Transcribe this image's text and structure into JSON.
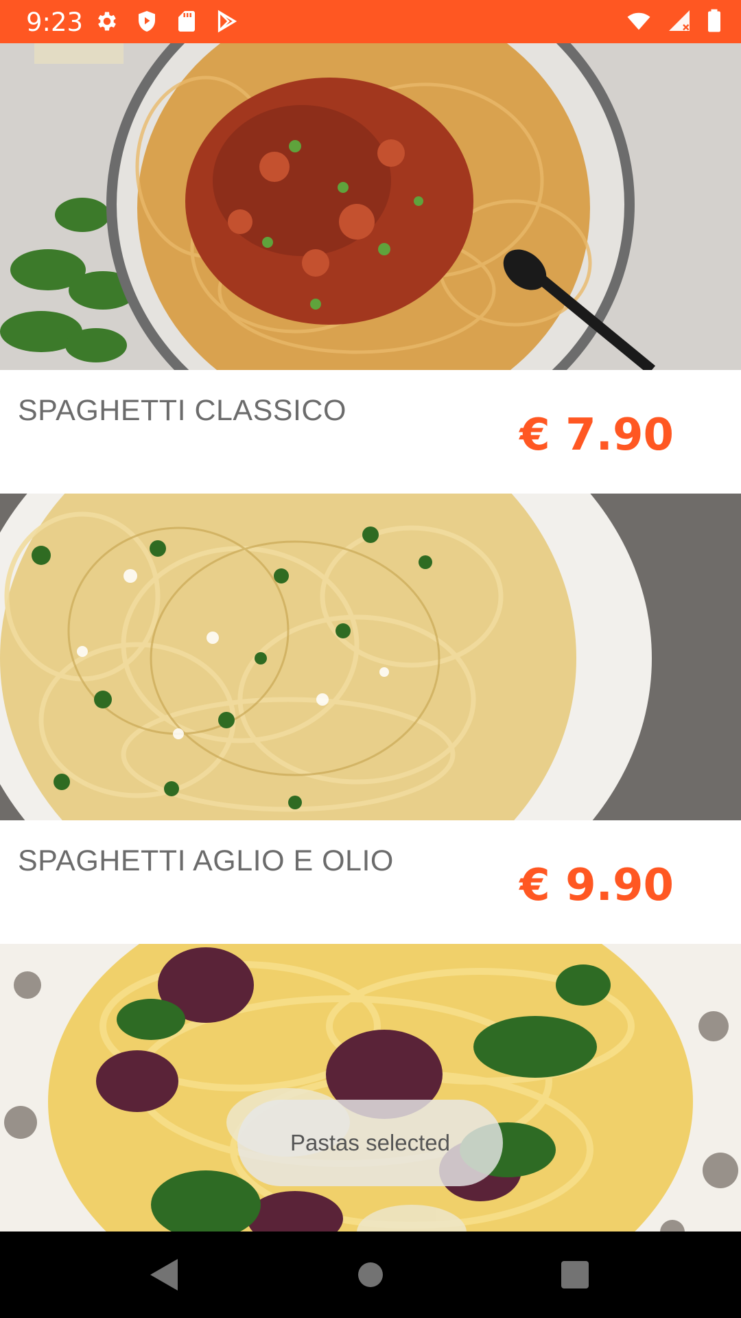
{
  "status_bar": {
    "time": "9:23",
    "background": "#FF5722",
    "left_icons": [
      "settings-icon",
      "shield-icon",
      "sd-card-icon",
      "play-store-icon"
    ],
    "right_icons": [
      "wifi-icon",
      "cell-signal-icon",
      "battery-icon"
    ]
  },
  "accent_color": "#FF5722",
  "menu_items": [
    {
      "name": "SPAGHETTI CLASSICO",
      "price": "€ 7.90",
      "image": "spaghetti-bolognese-photo"
    },
    {
      "name": "SPAGHETTI AGLIO E OLIO",
      "price": "€ 9.90",
      "image": "spaghetti-aglio-olio-photo"
    },
    {
      "name": "",
      "price": "",
      "image": "pasta-radicchio-spinach-photo"
    }
  ],
  "toast": {
    "text": "Pastas selected"
  },
  "nav_bar": {
    "buttons": [
      "back-icon",
      "home-icon",
      "recents-icon"
    ]
  }
}
